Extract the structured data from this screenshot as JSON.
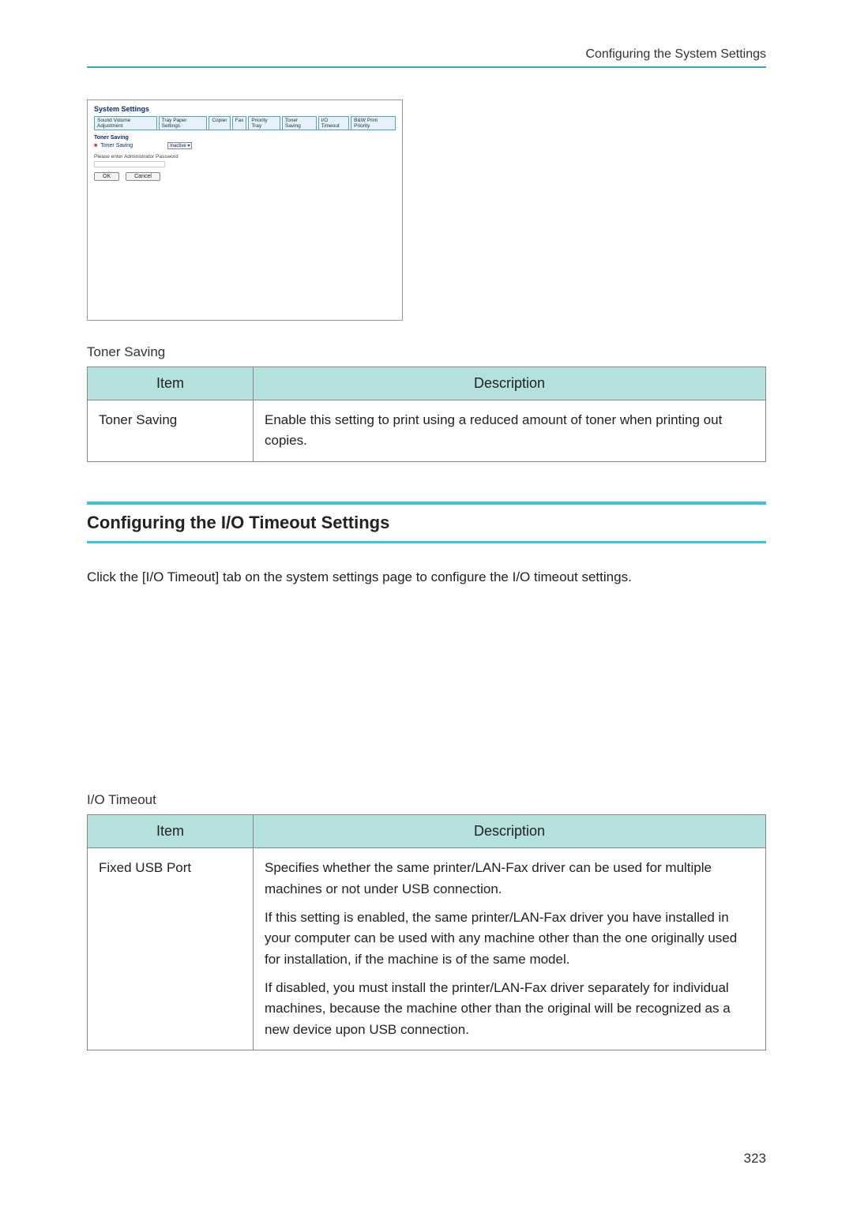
{
  "header": {
    "breadcrumb": "Configuring the System Settings"
  },
  "screenshot": {
    "title": "System Settings",
    "tabs": [
      "Sound Volume Adjustment",
      "Tray Paper Settings",
      "Copier",
      "Fax",
      "Priority Tray",
      "Toner Saving",
      "I/O Timeout",
      "B&W Print Priority"
    ],
    "section": "Toner Saving",
    "field_label": "Toner Saving",
    "select_value": "Inactive",
    "note": "Please enter Administrator Password",
    "ok": "OK",
    "cancel": "Cancel"
  },
  "toner_section": {
    "label": "Toner Saving",
    "col_item": "Item",
    "col_desc": "Description",
    "row_item": "Toner Saving",
    "row_desc": "Enable this setting to print using a reduced amount of toner when printing out copies."
  },
  "io_heading": "Configuring the I/O Timeout Settings",
  "io_intro": "Click the [I/O Timeout] tab on the system settings page to configure the I/O timeout settings.",
  "io_section": {
    "label": "I/O Timeout",
    "col_item": "Item",
    "col_desc": "Description",
    "row_item": "Fixed USB Port",
    "desc_p1": "Specifies whether the same printer/LAN-Fax driver can be used for multiple machines or not under USB connection.",
    "desc_p2": "If this setting is enabled, the same printer/LAN-Fax driver you have installed in your computer can be used with any machine other than the one originally used for installation, if the machine is of the same model.",
    "desc_p3": "If disabled, you must install the printer/LAN-Fax driver separately for individual machines, because the machine other than the original will be recognized as a new device upon USB connection."
  },
  "page_number": "323"
}
